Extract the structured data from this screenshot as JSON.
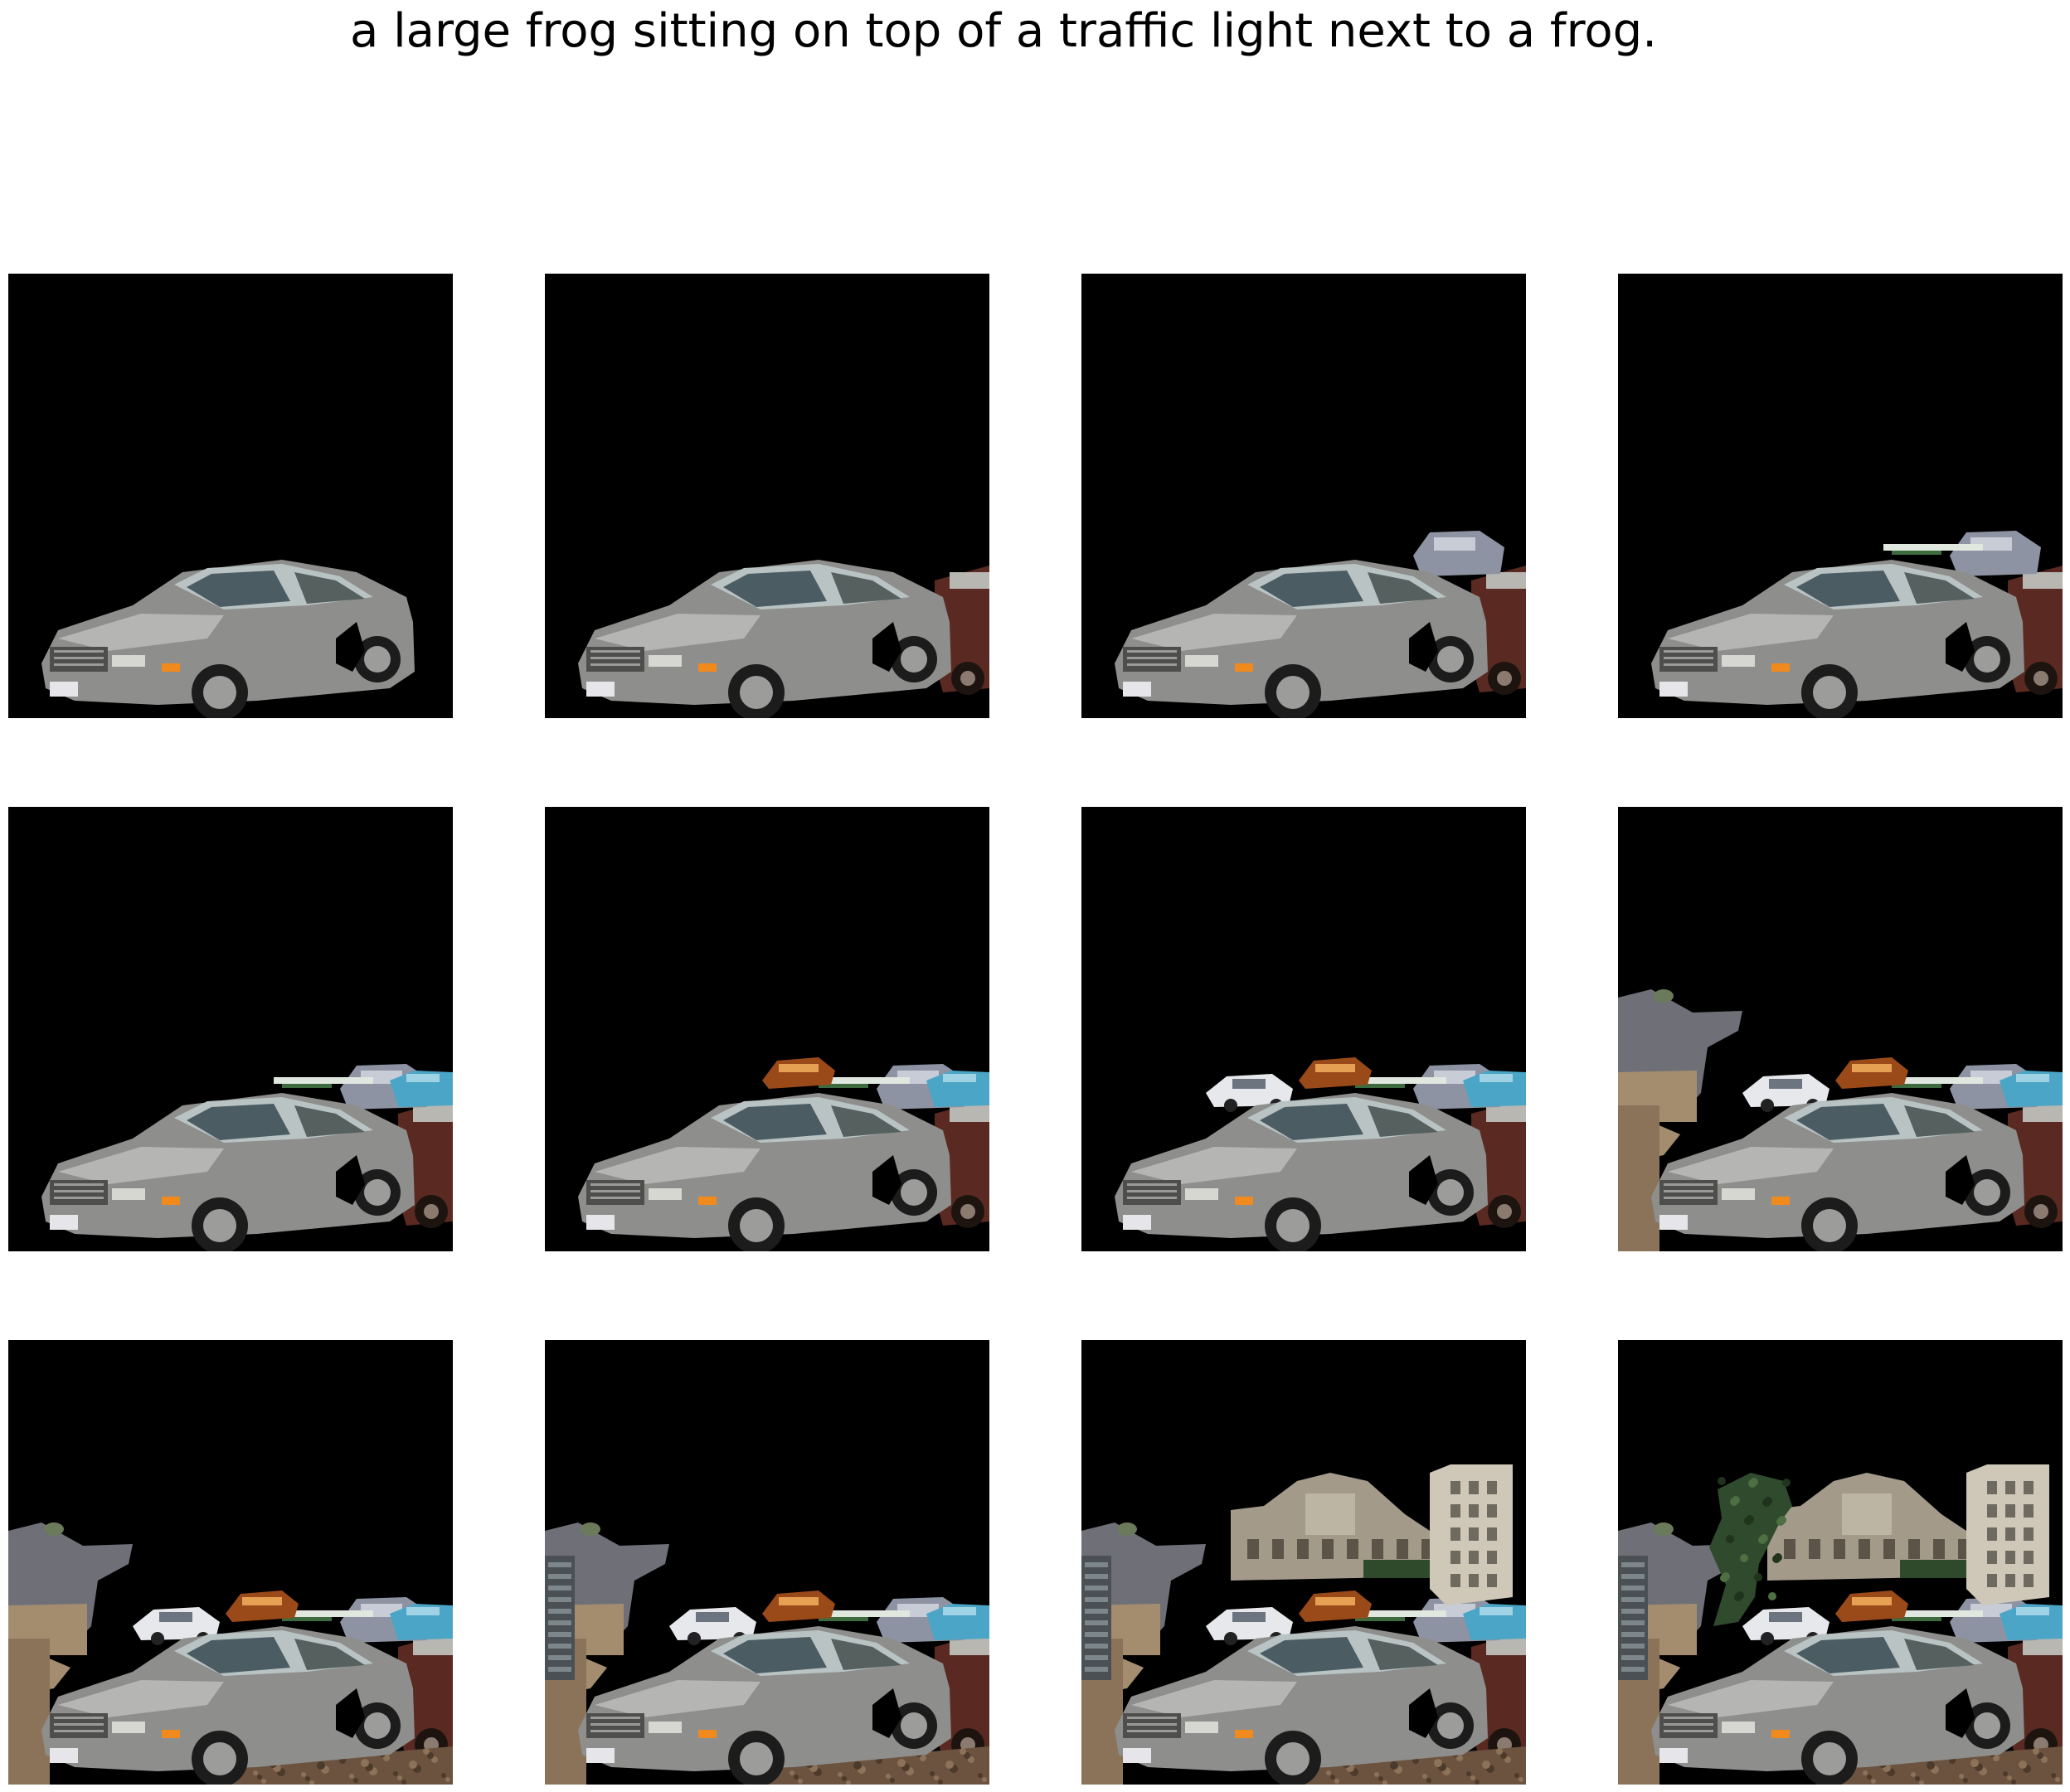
{
  "title": "a large frog sitting on top of a traffic light next to a frog.",
  "grid": {
    "rows": 3,
    "columns": 4,
    "panel_background": "#000000",
    "page_background": "#ffffff"
  },
  "panels": [
    {
      "row": 1,
      "col": 1,
      "layers": [
        "silver-sedan"
      ]
    },
    {
      "row": 1,
      "col": 2,
      "layers": [
        "silver-sedan",
        "dark-red-vintage-car-right"
      ]
    },
    {
      "row": 1,
      "col": 3,
      "layers": [
        "silver-sedan",
        "dark-red-vintage-car-right",
        "grey-minivan-behind"
      ]
    },
    {
      "row": 1,
      "col": 4,
      "layers": [
        "silver-sedan",
        "dark-red-vintage-car-right",
        "grey-minivan-behind",
        "white-roof-strip"
      ]
    },
    {
      "row": 2,
      "col": 1,
      "layers": [
        "silver-sedan",
        "dark-red-vintage-car-right",
        "grey-minivan-behind",
        "white-roof-strip",
        "blue-car-right"
      ]
    },
    {
      "row": 2,
      "col": 2,
      "layers": [
        "silver-sedan",
        "dark-red-vintage-car-right",
        "grey-minivan-behind",
        "white-roof-strip",
        "blue-car-right",
        "copper-object"
      ]
    },
    {
      "row": 2,
      "col": 3,
      "layers": [
        "silver-sedan",
        "dark-red-vintage-car-right",
        "grey-minivan-behind",
        "white-roof-strip",
        "blue-car-right",
        "copper-object",
        "small-white-car"
      ]
    },
    {
      "row": 2,
      "col": 4,
      "layers": [
        "silver-sedan",
        "dark-red-vintage-car-right",
        "grey-minivan-behind",
        "white-roof-strip",
        "blue-car-right",
        "copper-object",
        "small-white-car",
        "road-landscape-patch"
      ]
    },
    {
      "row": 3,
      "col": 1,
      "layers": [
        "silver-sedan",
        "dark-red-vintage-car-right",
        "grey-minivan-behind",
        "white-roof-strip",
        "blue-car-right",
        "copper-object",
        "small-white-car",
        "road-landscape-patch",
        "gravel-ground"
      ]
    },
    {
      "row": 3,
      "col": 2,
      "layers": [
        "silver-sedan",
        "dark-red-vintage-car-right",
        "grey-minivan-behind",
        "white-roof-strip",
        "blue-car-right",
        "copper-object",
        "small-white-car",
        "road-landscape-patch",
        "gravel-ground",
        "glass-building-left"
      ]
    },
    {
      "row": 3,
      "col": 3,
      "layers": [
        "silver-sedan",
        "dark-red-vintage-car-right",
        "grey-minivan-behind",
        "white-roof-strip",
        "blue-car-right",
        "copper-object",
        "small-white-car",
        "road-landscape-patch",
        "gravel-ground",
        "glass-building-left",
        "stone-buildings"
      ]
    },
    {
      "row": 3,
      "col": 4,
      "layers": [
        "silver-sedan",
        "dark-red-vintage-car-right",
        "grey-minivan-behind",
        "white-roof-strip",
        "blue-car-right",
        "copper-object",
        "small-white-car",
        "road-landscape-patch",
        "gravel-ground",
        "glass-building-left",
        "stone-buildings",
        "green-foliage"
      ]
    }
  ]
}
